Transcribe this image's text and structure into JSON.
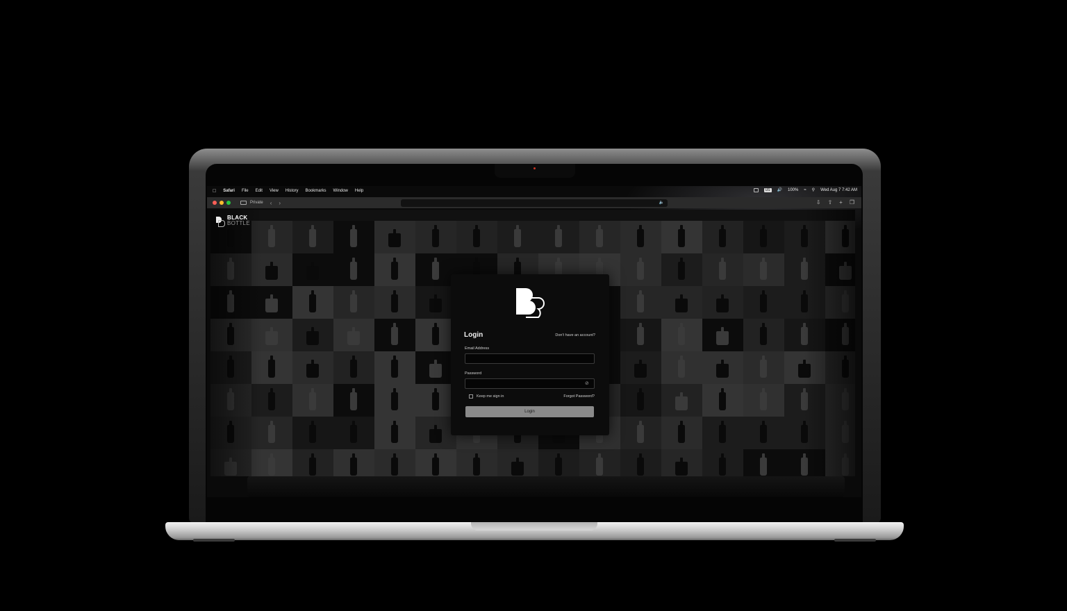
{
  "menubar": {
    "items": [
      "Safari",
      "File",
      "Edit",
      "View",
      "History",
      "Bookmarks",
      "Window",
      "Help"
    ],
    "status": {
      "battery": "100%",
      "datetime": "Wed Aug 7  7:42 AM",
      "input_badge": "US"
    }
  },
  "toolbar": {
    "private_label": "Private"
  },
  "brand": {
    "line1": "BLACK",
    "line2": "BOTTLE"
  },
  "login": {
    "title": "Login",
    "signup_link": "Don't have an account?",
    "email_label": "Email Address",
    "email_value": "",
    "password_label": "Password",
    "password_value": "",
    "remember_label": "Keep me sign in",
    "forgot_link": "Forgot Password?",
    "submit_label": "Login"
  },
  "icons": {
    "apple": "apple-icon",
    "eye": "eye-slash-icon",
    "share": "share-icon",
    "new_tab": "plus-icon",
    "tabs": "tabs-icon",
    "download": "download-icon"
  },
  "colors": {
    "background": "#000000",
    "card": "#0c0c0c",
    "button": "#8a8a8a",
    "traffic_red": "#ff5f57",
    "traffic_yellow": "#febc2e",
    "traffic_green": "#28c840"
  }
}
